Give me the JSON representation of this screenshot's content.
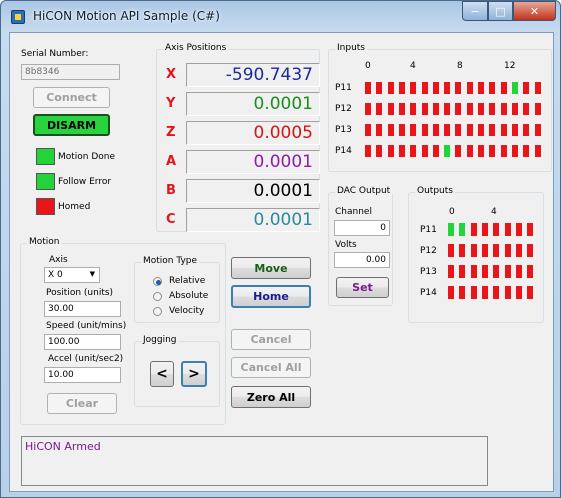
{
  "window": {
    "title": "HiCON Motion API Sample (C#)",
    "min": "−",
    "max": "□",
    "close": "✕"
  },
  "conn": {
    "serial_label": "Serial Number:",
    "serial_value": "8b8346",
    "connect": "Connect",
    "disarm": "DISARM",
    "indicators": [
      {
        "label": "Motion Done",
        "color": "#22d43a"
      },
      {
        "label": "Follow Error",
        "color": "#22d43a"
      },
      {
        "label": "Homed",
        "color": "#e8161b"
      }
    ]
  },
  "axis_positions": {
    "title": "Axis Positions",
    "axes": [
      {
        "name": "X",
        "value": "-590.7437",
        "color": "#1d2a9c"
      },
      {
        "name": "Y",
        "value": "0.0001",
        "color": "#1b8e1b"
      },
      {
        "name": "Z",
        "value": "0.0005",
        "color": "#d41414"
      },
      {
        "name": "A",
        "value": "0.0001",
        "color": "#8e1cab"
      },
      {
        "name": "B",
        "value": "0.0001",
        "color": "#000000"
      },
      {
        "name": "C",
        "value": "0.0001",
        "color": "#2a8a9a"
      }
    ]
  },
  "inputs": {
    "title": "Inputs",
    "ticks": [
      "0",
      "4",
      "8",
      "12"
    ],
    "rows": [
      {
        "label": "P11",
        "on": [
          13
        ]
      },
      {
        "label": "P12",
        "on": []
      },
      {
        "label": "P13",
        "on": []
      },
      {
        "label": "P14",
        "on": [
          7
        ]
      }
    ]
  },
  "dac": {
    "title": "DAC Output",
    "channel_label": "Channel",
    "channel_value": "0",
    "volts_label": "Volts",
    "volts_value": "0.00",
    "set": "Set"
  },
  "outputs": {
    "title": "Outputs",
    "ticks": [
      "0",
      "4"
    ],
    "rows": [
      {
        "label": "P11",
        "on": [
          0,
          1
        ]
      },
      {
        "label": "P12",
        "on": []
      },
      {
        "label": "P13",
        "on": []
      },
      {
        "label": "P14",
        "on": []
      }
    ]
  },
  "motion": {
    "title": "Motion",
    "axis_label": "Axis",
    "axis_value": "X 0",
    "pos_label": "Position (units)",
    "pos_value": "30.00",
    "speed_label": "Speed (unit/mins)",
    "speed_value": "100.00",
    "accel_label": "Accel (unit/sec2)",
    "accel_value": "10.00",
    "clear": "Clear",
    "type_title": "Motion Type",
    "types": [
      {
        "label": "Relative",
        "checked": true
      },
      {
        "label": "Absolute",
        "checked": false
      },
      {
        "label": "Velocity",
        "checked": false
      }
    ],
    "jog_title": "Jogging",
    "jog_left": "<",
    "jog_right": ">",
    "move": "Move",
    "home": "Home",
    "cancel": "Cancel",
    "cancel_all": "Cancel All",
    "zero_all": "Zero All"
  },
  "status": {
    "text": "HiCON Armed"
  }
}
